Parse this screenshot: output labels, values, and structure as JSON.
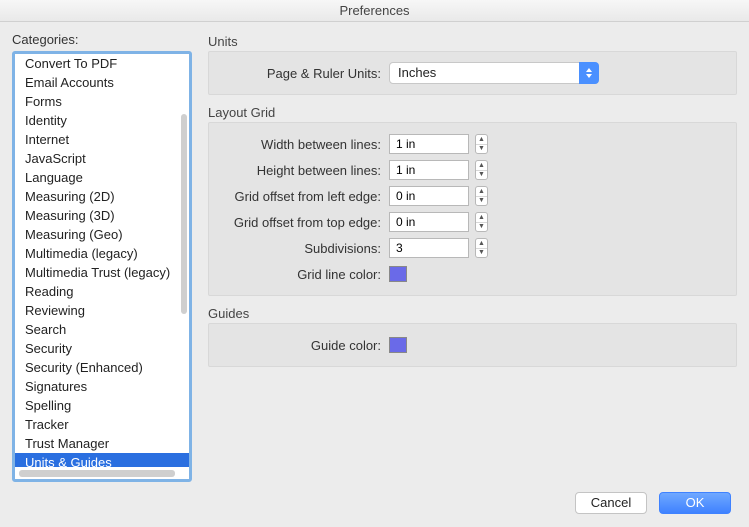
{
  "window": {
    "title": "Preferences"
  },
  "sidebar": {
    "label": "Categories:",
    "items": [
      "Convert To PDF",
      "Email Accounts",
      "Forms",
      "Identity",
      "Internet",
      "JavaScript",
      "Language",
      "Measuring (2D)",
      "Measuring (3D)",
      "Measuring (Geo)",
      "Multimedia (legacy)",
      "Multimedia Trust (legacy)",
      "Reading",
      "Reviewing",
      "Search",
      "Security",
      "Security (Enhanced)",
      "Signatures",
      "Spelling",
      "Tracker",
      "Trust Manager",
      "Units & Guides"
    ],
    "selected_index": 21
  },
  "sections": {
    "units": {
      "title": "Units",
      "page_ruler_label": "Page & Ruler Units:",
      "page_ruler_value": "Inches"
    },
    "layout_grid": {
      "title": "Layout Grid",
      "width_label": "Width between lines:",
      "width_value": "1 in",
      "height_label": "Height between lines:",
      "height_value": "1 in",
      "offset_left_label": "Grid offset from left edge:",
      "offset_left_value": "0 in",
      "offset_top_label": "Grid offset from top edge:",
      "offset_top_value": "0 in",
      "subdivisions_label": "Subdivisions:",
      "subdivisions_value": "3",
      "line_color_label": "Grid line color:",
      "line_color_value": "#6a6ae8"
    },
    "guides": {
      "title": "Guides",
      "color_label": "Guide color:",
      "color_value": "#6a6ae8"
    }
  },
  "footer": {
    "cancel": "Cancel",
    "ok": "OK"
  }
}
